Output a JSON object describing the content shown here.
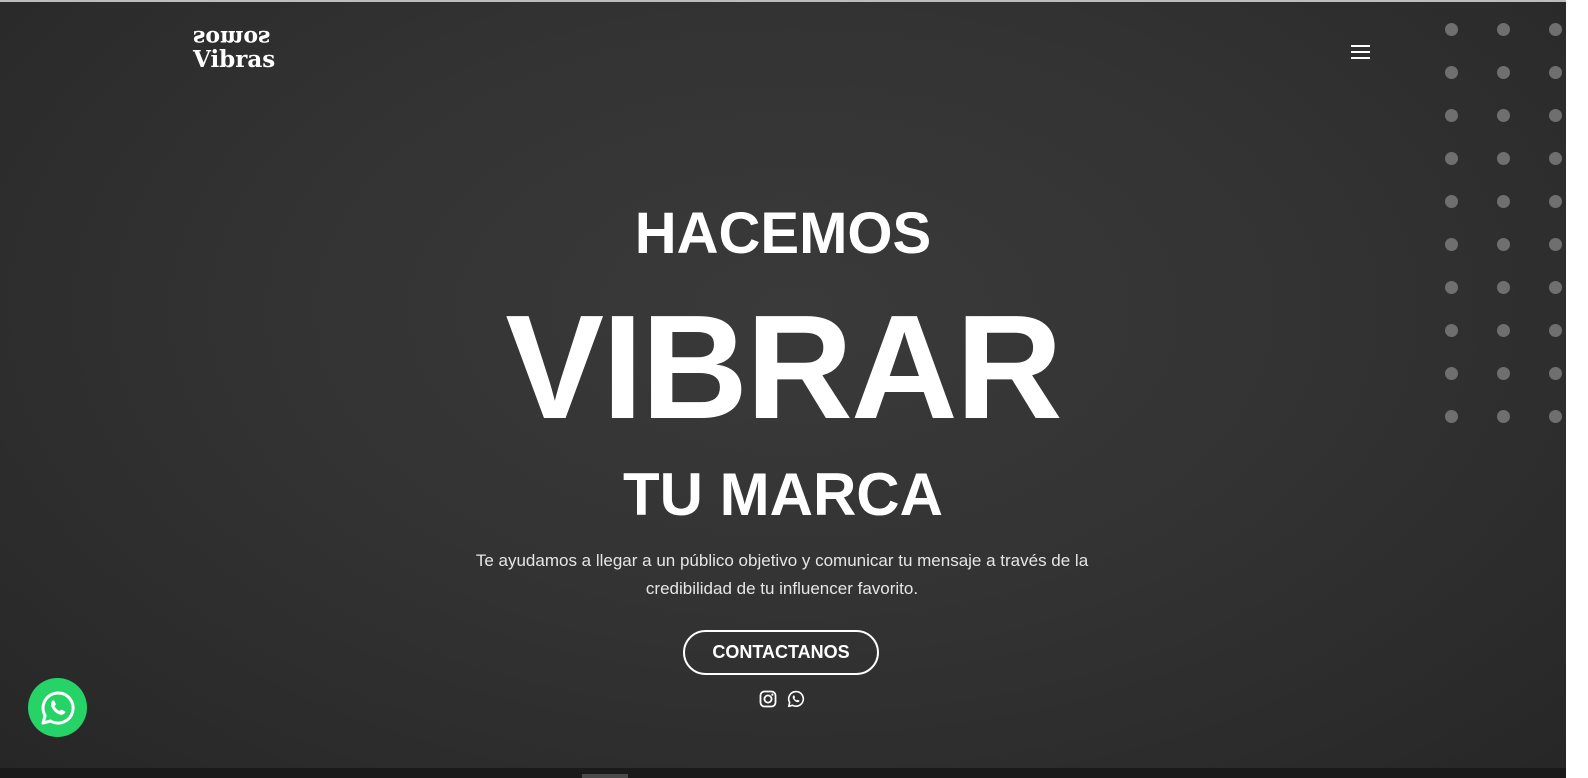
{
  "header": {
    "logo_line1": "somos",
    "logo_line2": "Vibras",
    "menu_icon": "hamburger-icon"
  },
  "hero": {
    "headline_top": "HACEMOS",
    "headline_main": "VIBRAR",
    "headline_bottom": "TU MARCA",
    "description": "Te ayudamos a llegar a un público objetivo y comunicar tu mensaje a través de la credibilidad de tu influencer favorito.",
    "cta_label": "CONTACTANOS",
    "social_icons": [
      "instagram-icon",
      "whatsapp-icon"
    ]
  },
  "floating": {
    "whatsapp_icon": "whatsapp-icon"
  },
  "colors": {
    "background": "#2e2e2e",
    "text": "#ffffff",
    "whatsapp_green": "#25d366",
    "dot_gray": "#6f6f6f"
  }
}
